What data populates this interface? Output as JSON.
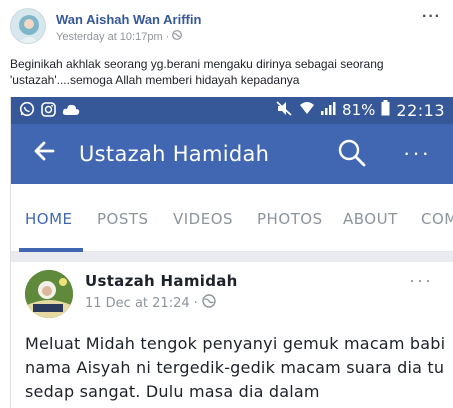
{
  "post": {
    "author": "Wan Aishah Wan Ariffin",
    "timestamp": "Yesterday at 10:17pm",
    "separator": "·",
    "text": "Beginikah akhlak seorang yg.berani mengaku dirinya sebagai seorang 'ustazah'....semoga Allah memberi hidayah kepadanya",
    "menu_label": "···"
  },
  "screenshot": {
    "status_bar": {
      "battery": "81%",
      "time": "22:13"
    },
    "app_bar": {
      "title": "Ustazah Hamidah",
      "more_label": "···"
    },
    "tabs": [
      {
        "label": "HOME",
        "active": true
      },
      {
        "label": "POSTS",
        "active": false
      },
      {
        "label": "VIDEOS",
        "active": false
      },
      {
        "label": "PHOTOS",
        "active": false
      },
      {
        "label": "ABOUT",
        "active": false
      },
      {
        "label": "COM",
        "active": false
      }
    ],
    "card": {
      "name": "Ustazah Hamidah",
      "date": "11 Dec at 21:24",
      "separator": "·",
      "menu_label": "···",
      "text": "Meluat Midah tengok penyanyi gemuk macam babi nama Aisyah ni tergedik-gedik macam suara dia tu sedap sangat. Dulu masa dia dalam"
    }
  },
  "colors": {
    "link_blue": "#365899",
    "fb_blue": "#4267b2",
    "status_bar": "#365899",
    "muted": "#90949c"
  }
}
